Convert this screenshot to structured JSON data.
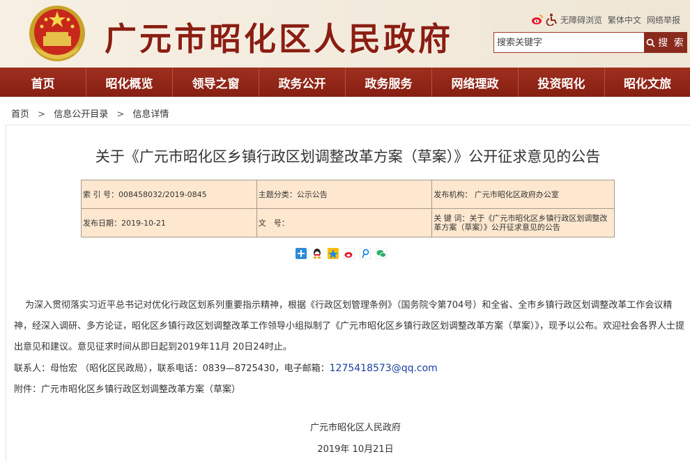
{
  "header": {
    "site_title": "广元市昭化区人民政府",
    "utility": {
      "accessible": "无障碍浏览",
      "traditional": "繁体中文",
      "report": "网络举报"
    },
    "search": {
      "placeholder": "搜索关键字",
      "button_label": "搜 索"
    }
  },
  "nav": {
    "items": [
      "首页",
      "昭化概览",
      "领导之窗",
      "政务公开",
      "政务服务",
      "网络理政",
      "投资昭化",
      "昭化文旅"
    ]
  },
  "breadcrumb": {
    "items": [
      "首页",
      "信息公开目录",
      "信息详情"
    ],
    "separator": ">"
  },
  "article": {
    "title": "关于《广元市昭化区乡镇行政区划调整改革方案（草案）》公开征求意见的公告",
    "meta": {
      "index_no": "索 引 号：008458032/2019-0845",
      "category": "主题分类：公示公告",
      "publisher": "发布机构： 广元市昭化区政府办公室",
      "date": "发布日期：2019-10-21",
      "doc_no": "文　号：",
      "keywords": "关 键 词：关于《广元市昭化区乡镇行政区划调整改革方案（草案）》公开征求意见的公告"
    },
    "paragraph1": "为深入贯彻落实习近平总书记对优化行政区划系列重要指示精神，根据《行政区划管理条例》（国务院令第704号）和全省、全市乡镇行政区划调整改革工作会议精神，经深入调研、多方论证，昭化区乡镇行政区划调整改革工作领导小组拟制了《广元市昭化区乡镇行政区划调整改革方案（草案）》，现予以公布。欢迎社会各界人士提出意见和建议。意见征求时间从即日起到2019年11月 20日24时止。",
    "contact": "联系人：母怡宏 （昭化区民政局），联系电话：0839—8725430，电子邮箱：",
    "email": "1275418573@qq.com",
    "attachment": "附件：广元市昭化区乡镇行政区划调整改革方案（草案）",
    "signature": "广元市昭化区人民政府",
    "sign_date": "2019年 10月21日"
  },
  "colors": {
    "brand_red": "#8b1d12",
    "nav_red": "#8a2a1c",
    "meta_bg": "#fde7cf",
    "link_blue": "#1a3fa0"
  },
  "icons": [
    "national-emblem-icon",
    "weibo-icon",
    "accessibility-icon",
    "search-icon",
    "share-plus-icon",
    "qq-icon",
    "qzone-icon",
    "sina-weibo-icon",
    "tencent-weibo-icon",
    "wechat-icon"
  ]
}
